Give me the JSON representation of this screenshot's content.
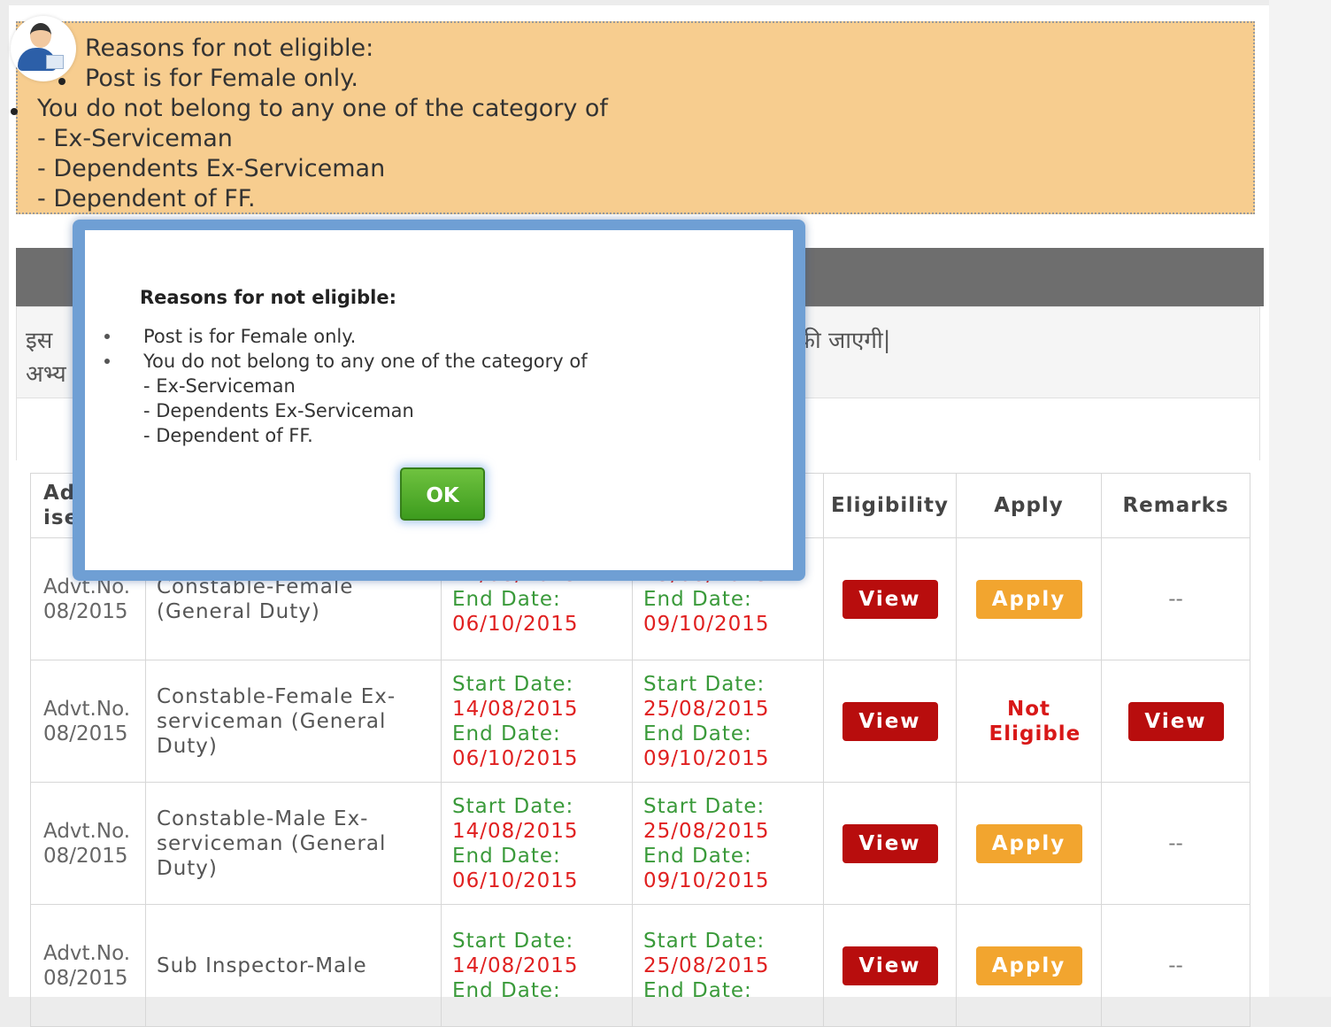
{
  "banner": {
    "heading": "Reasons for not eligible:",
    "line1": "Post is for Female only.",
    "line2": "You do not belong to any one of the category of",
    "line3": "- Ex-Serviceman",
    "line4": "- Dependents Ex-Serviceman",
    "line5": "- Dependent of FF."
  },
  "notice": {
    "line1_start": "इस",
    "line1_end": "की जाएगी|",
    "line2_start": "अभ्य"
  },
  "table": {
    "headers": {
      "adv_partial": "Adv\nise",
      "eligibility": "Eligibility",
      "apply": "Apply",
      "remarks": "Remarks"
    },
    "rows": [
      {
        "adv": "Advt.No. 08/2015",
        "post": "Constable-Female (General Duty)",
        "reg_start_label": "",
        "reg_start": "14/08/2015",
        "reg_end_label": "End Date:",
        "reg_end": "06/10/2015",
        "fee_start_label": "",
        "fee_start": "25/08/2015",
        "fee_end_label": "End Date:",
        "fee_end": "09/10/2015",
        "eligibility": "View",
        "apply": "Apply",
        "remarks": "--"
      },
      {
        "adv": "Advt.No. 08/2015",
        "post": "Constable-Female Ex-serviceman (General Duty)",
        "reg_start_label": "Start Date:",
        "reg_start": "14/08/2015",
        "reg_end_label": "End Date:",
        "reg_end": "06/10/2015",
        "fee_start_label": "Start Date:",
        "fee_start": "25/08/2015",
        "fee_end_label": "End Date:",
        "fee_end": "09/10/2015",
        "eligibility": "View",
        "apply": "Not Eligible",
        "remarks": "View"
      },
      {
        "adv": "Advt.No. 08/2015",
        "post": "Constable-Male Ex-serviceman (General Duty)",
        "reg_start_label": "Start Date:",
        "reg_start": "14/08/2015",
        "reg_end_label": "End Date:",
        "reg_end": "06/10/2015",
        "fee_start_label": "Start Date:",
        "fee_start": "25/08/2015",
        "fee_end_label": "End Date:",
        "fee_end": "09/10/2015",
        "eligibility": "View",
        "apply": "Apply",
        "remarks": "--"
      },
      {
        "adv": "Advt.No. 08/2015",
        "post": "Sub Inspector-Male",
        "reg_start_label": "Start Date:",
        "reg_start": "14/08/2015",
        "reg_end_label": "End Date:",
        "reg_end": "",
        "fee_start_label": "Start Date:",
        "fee_start": "25/08/2015",
        "fee_end_label": "End Date:",
        "fee_end": "",
        "eligibility": "View",
        "apply": "Apply",
        "remarks": "--"
      }
    ]
  },
  "modal": {
    "title": "Reasons for not eligible:",
    "item1": "Post is for Female only.",
    "item2": "You do not belong to any one of the category of",
    "sub1": "- Ex-Serviceman",
    "sub2": "- Dependents Ex-Serviceman",
    "sub3": "- Dependent of FF.",
    "ok_label": "OK"
  },
  "colors": {
    "banner_bg": "#f7cd8f",
    "view_button": "#b80d0d",
    "apply_button": "#f2a52f",
    "ok_button": "#4fae28",
    "date_label": "#3a9a3a",
    "date_value": "#e02020"
  },
  "icons": {
    "avatar": "user-avatar-icon"
  }
}
